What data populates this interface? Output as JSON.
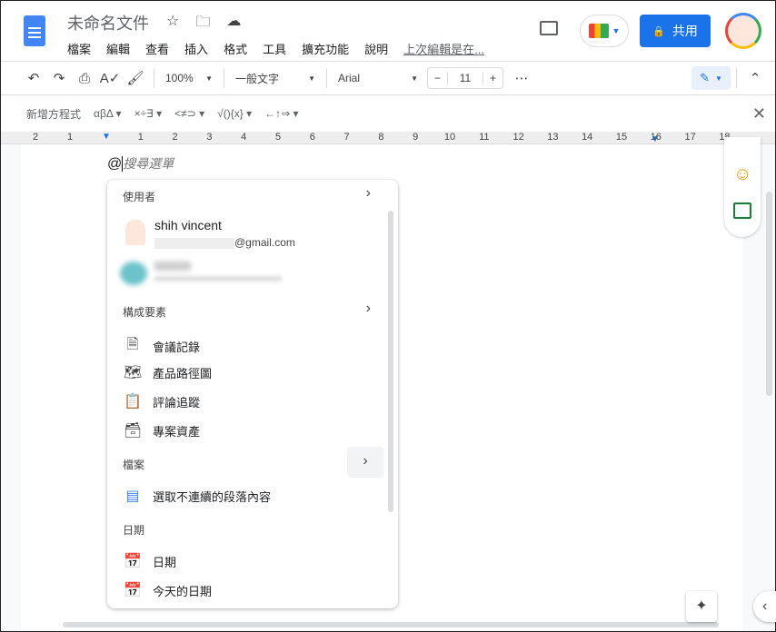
{
  "header": {
    "title": "未命名文件",
    "menu": [
      "檔案",
      "編輯",
      "查看",
      "插入",
      "格式",
      "工具",
      "擴充功能",
      "說明"
    ],
    "last_edit": "上次編輯是在...",
    "share": "共用"
  },
  "toolbar": {
    "zoom": "100%",
    "style": "一般文字",
    "font": "Arial",
    "size": "11"
  },
  "equation": {
    "new": "新增方程式",
    "groups": [
      "αβΔ",
      "×÷∃",
      "<≠⊃",
      "√(){x}",
      "←↑⇒"
    ]
  },
  "ruler": [
    "2",
    "1",
    "1",
    "2",
    "3",
    "4",
    "5",
    "6",
    "7",
    "8",
    "9",
    "10",
    "11",
    "12",
    "13",
    "14",
    "15",
    "16",
    "17",
    "18"
  ],
  "doc": {
    "at": "@",
    "placeholder": "搜尋選單"
  },
  "popup": {
    "people_label": "使用者",
    "person": {
      "name": "shih vincent",
      "email_suffix": "@gmail.com"
    },
    "blocks_label": "構成要素",
    "blocks": [
      "會議記錄",
      "產品路徑圖",
      "評論追蹤",
      "專案資產"
    ],
    "files_label": "檔案",
    "file": "選取不連續的段落內容",
    "dates_label": "日期",
    "dates": [
      "日期",
      "今天的日期"
    ]
  },
  "colors": {
    "accent": "#1a73e8"
  }
}
